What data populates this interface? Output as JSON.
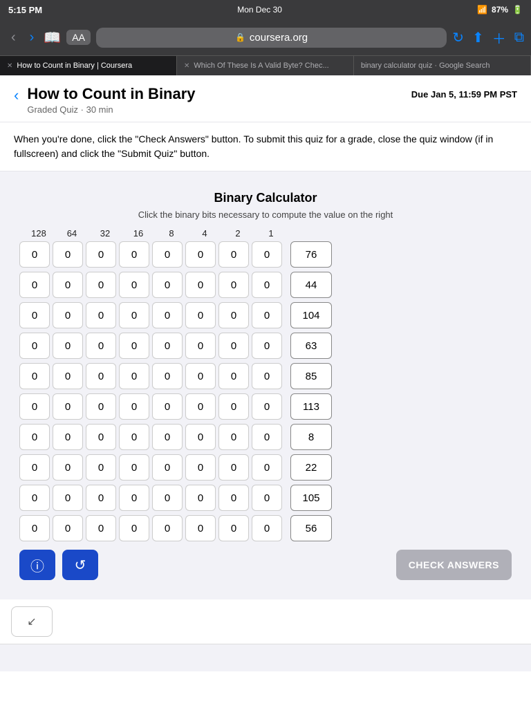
{
  "status": {
    "time": "5:15 PM",
    "day": "Mon Dec 30",
    "wifi": "87%",
    "battery": "87%"
  },
  "browser": {
    "aa_label": "AA",
    "url": "coursera.org"
  },
  "tabs": [
    {
      "id": "tab1",
      "label": "How to Count in Binary | Coursera",
      "active": true
    },
    {
      "id": "tab2",
      "label": "Which Of These Is A Valid Byte? Chec...",
      "active": false
    },
    {
      "id": "tab3",
      "label": "binary calculator quiz · Google Search",
      "active": false
    }
  ],
  "page": {
    "title": "How to Count in Binary",
    "subtitle": "Graded Quiz · 30 min",
    "due_label": "Due",
    "due_date": "Jan 5, 11:59 PM PST"
  },
  "instruction": "When you're done, click the \"Check Answers\" button. To submit this quiz for a grade, close the quiz window (if in fullscreen) and click the \"Submit Quiz\" button.",
  "quiz": {
    "title": "Binary Calculator",
    "subtitle": "Click the binary bits necessary to compute the value on the right",
    "column_headers": [
      "128",
      "64",
      "32",
      "16",
      "8",
      "4",
      "2",
      "1"
    ],
    "rows": [
      {
        "bits": [
          0,
          0,
          0,
          0,
          0,
          0,
          0,
          0
        ],
        "result": 76
      },
      {
        "bits": [
          0,
          0,
          0,
          0,
          0,
          0,
          0,
          0
        ],
        "result": 44
      },
      {
        "bits": [
          0,
          0,
          0,
          0,
          0,
          0,
          0,
          0
        ],
        "result": 104
      },
      {
        "bits": [
          0,
          0,
          0,
          0,
          0,
          0,
          0,
          0
        ],
        "result": 63
      },
      {
        "bits": [
          0,
          0,
          0,
          0,
          0,
          0,
          0,
          0
        ],
        "result": 85
      },
      {
        "bits": [
          0,
          0,
          0,
          0,
          0,
          0,
          0,
          0
        ],
        "result": 113
      },
      {
        "bits": [
          0,
          0,
          0,
          0,
          0,
          0,
          0,
          0
        ],
        "result": 8
      },
      {
        "bits": [
          0,
          0,
          0,
          0,
          0,
          0,
          0,
          0
        ],
        "result": 22
      },
      {
        "bits": [
          0,
          0,
          0,
          0,
          0,
          0,
          0,
          0
        ],
        "result": 105
      },
      {
        "bits": [
          0,
          0,
          0,
          0,
          0,
          0,
          0,
          0
        ],
        "result": 56
      }
    ],
    "info_button": "ℹ",
    "reset_button": "↺",
    "check_button": "CHECK ANSWERS"
  },
  "expand_icon": "↙"
}
